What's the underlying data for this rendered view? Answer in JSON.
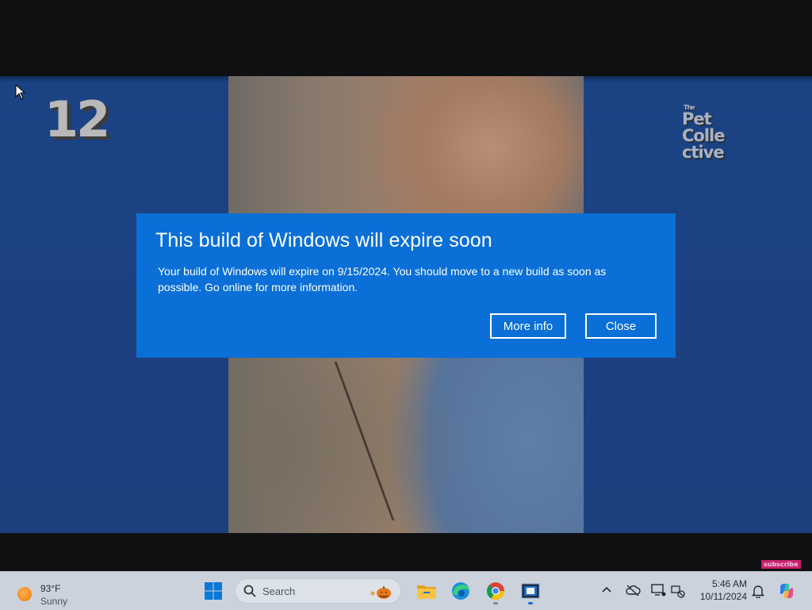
{
  "video": {
    "channel_number": "12",
    "logo_lines": [
      "The",
      "Pet",
      "Colle",
      "ctive"
    ],
    "subscribe_badge": "subscribe"
  },
  "dialog": {
    "title": "This build of Windows will expire soon",
    "body": "Your build of Windows will expire on 9/15/2024. You should move to a new build as soon as possible. Go online for more information.",
    "more_info_label": "More info",
    "close_label": "Close",
    "accent": "#0a6fd6"
  },
  "taskbar": {
    "weather": {
      "temp": "93°F",
      "condition": "Sunny",
      "icon": "sun-icon"
    },
    "search": {
      "placeholder": "Search"
    },
    "apps": [
      {
        "name": "file-explorer",
        "icon": "folder-icon"
      },
      {
        "name": "edge",
        "icon": "edge-icon"
      },
      {
        "name": "chrome",
        "icon": "chrome-icon"
      },
      {
        "name": "active-window",
        "icon": "window-icon"
      }
    ],
    "clock": {
      "time": "5:46 AM",
      "date": "10/11/2024"
    }
  }
}
